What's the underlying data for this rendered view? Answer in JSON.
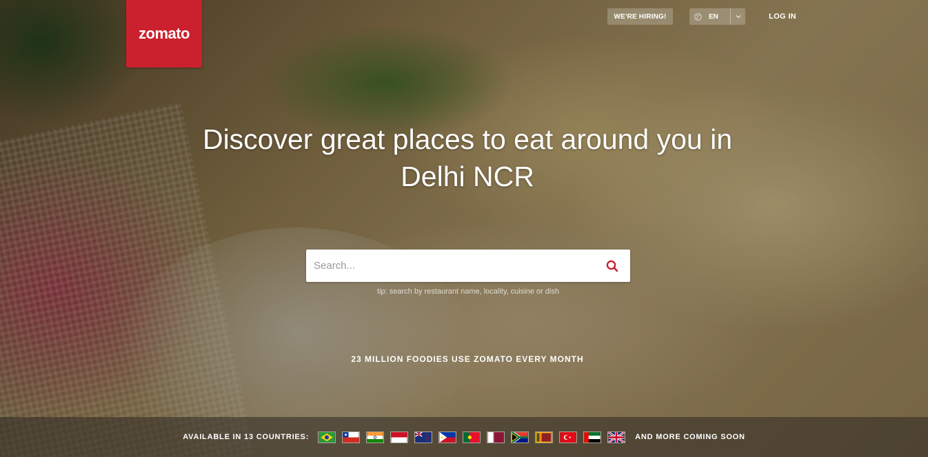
{
  "brand": {
    "logo_text": "zomato",
    "color": "#cb202d"
  },
  "header": {
    "hiring_label": "WE'RE HIRING!",
    "language_label": "EN",
    "login_label": "LOG IN"
  },
  "hero": {
    "headline": "Discover great places to eat around you in Delhi NCR"
  },
  "search": {
    "placeholder": "Search...",
    "value": "",
    "tip": "tip: search by restaurant name, locality, cuisine or dish"
  },
  "stat_text": "23 MILLION FOODIES USE ZOMATO EVERY MONTH",
  "countries": {
    "label": "AVAILABLE IN 13 COUNTRIES:",
    "more_label": "AND MORE COMING SOON",
    "flags": [
      "brazil-flag-icon",
      "chile-flag-icon",
      "india-flag-icon",
      "indonesia-flag-icon",
      "new-zealand-flag-icon",
      "philippines-flag-icon",
      "portugal-flag-icon",
      "qatar-flag-icon",
      "south-africa-flag-icon",
      "sri-lanka-flag-icon",
      "turkey-flag-icon",
      "uae-flag-icon",
      "uk-flag-icon"
    ]
  }
}
